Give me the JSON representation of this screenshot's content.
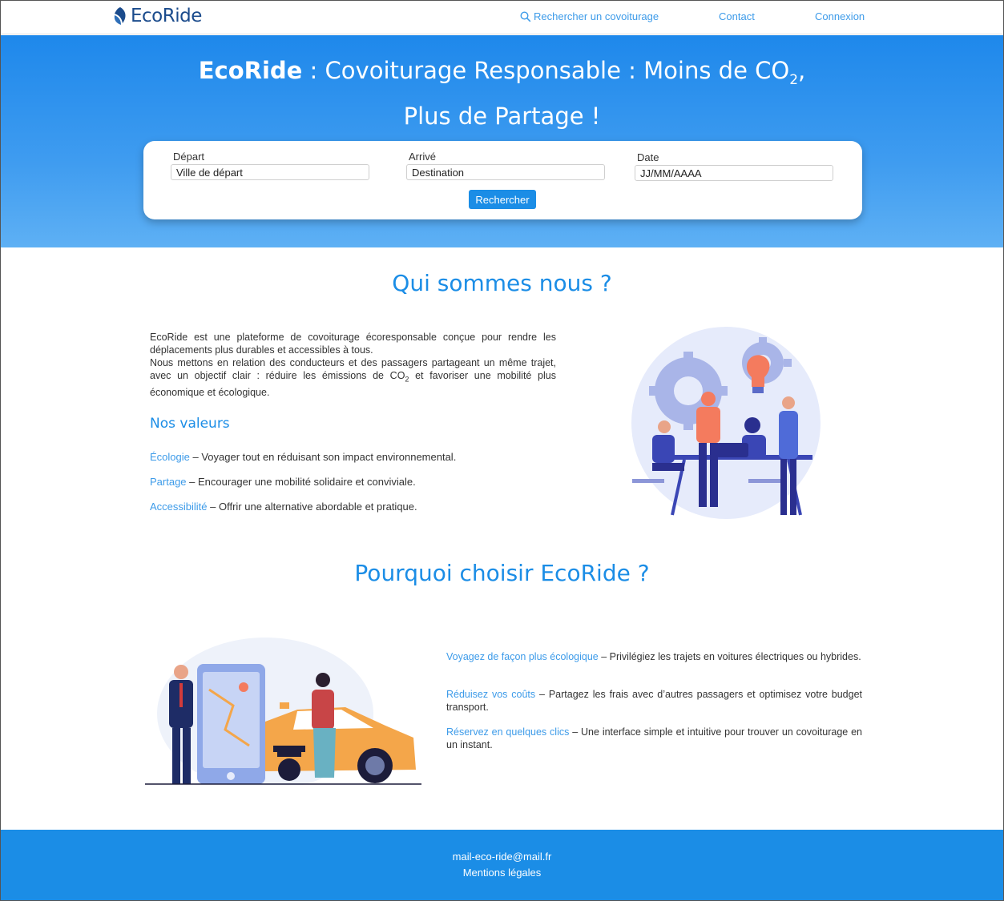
{
  "nav": {
    "logo_text": "EcoRide",
    "search_link": "Rechercher un covoiturage",
    "contact": "Contact",
    "login": "Connexion"
  },
  "hero": {
    "brand": "EcoRide",
    "title_part1": " : Covoiturage Responsable : Moins de CO",
    "subscript": "2",
    "title_part2": ",",
    "title_line2": "Plus de Partage !"
  },
  "search": {
    "depart_label": "Départ",
    "depart_placeholder": "Ville de départ",
    "arrive_label": "Arrivé",
    "arrive_placeholder": "Destination",
    "date_label": "Date",
    "date_placeholder": "JJ/MM/AAAA",
    "button": "Rechercher"
  },
  "about": {
    "title": "Qui sommes nous ?",
    "paragraph1": "EcoRide est une plateforme de covoiturage écoresponsable conçue pour rendre les déplacements plus durables et accessibles à tous.",
    "paragraph2_a": "Nous mettons en relation des conducteurs et des passagers partageant un même trajet, avec un objectif clair : réduire les émissions de CO",
    "paragraph2_sub": "2",
    "paragraph2_b": " et favoriser une mobilité plus économique et écologique.",
    "values_title": "Nos valeurs",
    "values": [
      {
        "name": "Écologie",
        "text": " – Voyager tout en réduisant son impact environnemental."
      },
      {
        "name": "Partage",
        "text": " – Encourager une mobilité solidaire et conviviale."
      },
      {
        "name": "Accessibilité",
        "text": " – Offrir une alternative abordable et pratique."
      }
    ]
  },
  "why": {
    "title": "Pourquoi choisir EcoRide ?",
    "items": [
      {
        "name": "Voyagez de façon plus écologique",
        "text": " – Privilégiez les trajets en voitures électriques ou hybrides."
      },
      {
        "name": "Réduisez vos coûts",
        "text": " – Partagez les frais avec d’autres passagers et optimisez votre budget transport."
      },
      {
        "name": "Réservez en quelques clics",
        "text": " – Une interface simple et intuitive pour trouver un covoiturage en un instant."
      }
    ]
  },
  "footer": {
    "email": "mail-eco-ride@mail.fr",
    "legal": "Mentions légales"
  },
  "colors": {
    "primary": "#1b8de6",
    "accent_text": "#3d9be9",
    "logo": "#1b4b8c"
  },
  "icons": {
    "search": "search-icon",
    "logo": "leaf-logo-icon"
  }
}
